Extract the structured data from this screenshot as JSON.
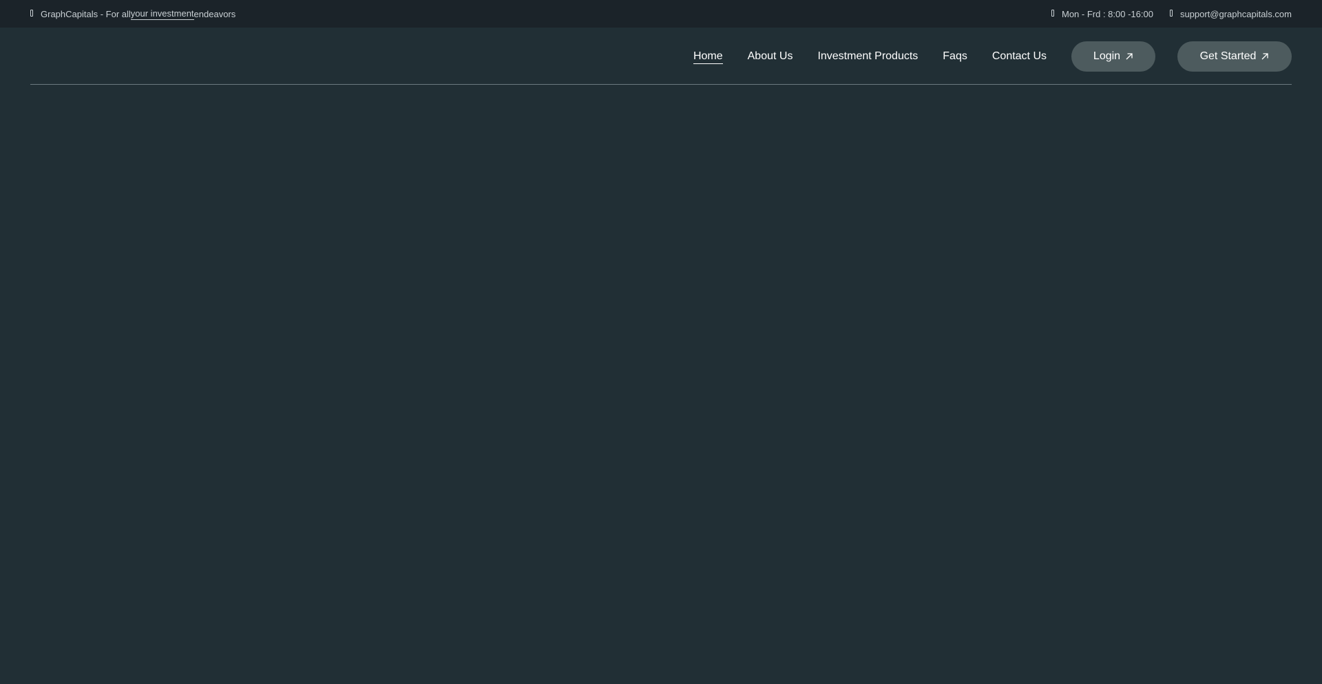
{
  "topbar": {
    "tagline_prefix": "GraphCapitals - For all ",
    "tagline_link": "your investment",
    "tagline_suffix": " endeavors",
    "hours": "Mon - Frd : 8:00 -16:00",
    "email": "support@graphcapitals.com"
  },
  "nav": {
    "items": [
      {
        "label": "Home",
        "active": true
      },
      {
        "label": "About Us"
      },
      {
        "label": "Investment Products"
      },
      {
        "label": "Faqs"
      },
      {
        "label": "Contact Us"
      }
    ],
    "login_label": "Login",
    "get_started_label": "Get Started"
  },
  "icons": {
    "tagline": "info-icon",
    "hours": "clock-icon",
    "email": "envelope-icon",
    "button_arrow": "arrow-up-right-icon"
  },
  "colors": {
    "page_background": "#212f35",
    "topbar_background": "#1b2329",
    "button_background": "#4d5b5e",
    "text": "#ffffff"
  }
}
